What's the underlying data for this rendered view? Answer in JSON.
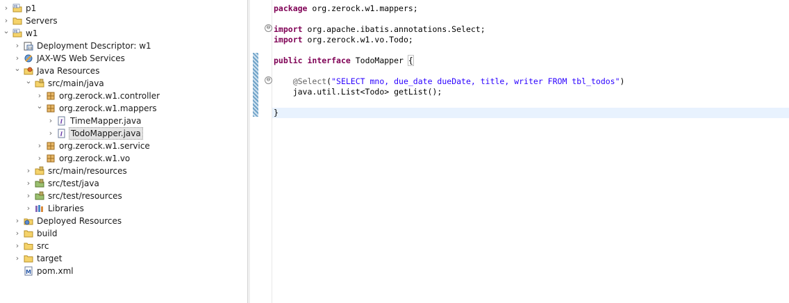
{
  "explorer": {
    "items": [
      {
        "label": "p1",
        "icon": "maven-project-icon",
        "expanded": false,
        "selected": false
      },
      {
        "label": "Servers",
        "icon": "folder-icon",
        "expanded": false,
        "selected": false
      },
      {
        "label": "w1",
        "icon": "maven-project-icon",
        "expanded": true,
        "selected": false
      },
      {
        "label": "Deployment Descriptor: w1",
        "icon": "deployment-descriptor-icon",
        "expanded": false,
        "selected": false
      },
      {
        "label": "JAX-WS Web Services",
        "icon": "web-services-icon",
        "expanded": false,
        "selected": false
      },
      {
        "label": "Java Resources",
        "icon": "java-resources-icon",
        "expanded": true,
        "selected": false
      },
      {
        "label": "src/main/java",
        "icon": "source-folder-icon",
        "expanded": true,
        "selected": false
      },
      {
        "label": "org.zerock.w1.controller",
        "icon": "package-icon",
        "expanded": false,
        "selected": false
      },
      {
        "label": "org.zerock.w1.mappers",
        "icon": "package-icon",
        "expanded": true,
        "selected": false
      },
      {
        "label": "TimeMapper.java",
        "icon": "java-interface-file-icon",
        "expanded": false,
        "selected": false
      },
      {
        "label": "TodoMapper.java",
        "icon": "java-interface-file-icon",
        "expanded": false,
        "selected": true
      },
      {
        "label": "org.zerock.w1.service",
        "icon": "package-icon",
        "expanded": false,
        "selected": false
      },
      {
        "label": "org.zerock.w1.vo",
        "icon": "package-icon",
        "expanded": false,
        "selected": false
      },
      {
        "label": "src/main/resources",
        "icon": "source-folder-icon",
        "expanded": false,
        "selected": false
      },
      {
        "label": "src/test/java",
        "icon": "test-source-folder-icon",
        "expanded": false,
        "selected": false
      },
      {
        "label": "src/test/resources",
        "icon": "test-source-folder-icon",
        "expanded": false,
        "selected": false
      },
      {
        "label": "Libraries",
        "icon": "libraries-icon",
        "expanded": false,
        "selected": false
      },
      {
        "label": "Deployed Resources",
        "icon": "deployed-resources-icon",
        "expanded": false,
        "selected": false
      },
      {
        "label": "build",
        "icon": "folder-icon",
        "expanded": false,
        "selected": false
      },
      {
        "label": "src",
        "icon": "folder-icon",
        "expanded": false,
        "selected": false
      },
      {
        "label": "target",
        "icon": "folder-icon",
        "expanded": false,
        "selected": false
      },
      {
        "label": "pom.xml",
        "icon": "maven-pom-file-icon",
        "expanded": null,
        "selected": false
      }
    ]
  },
  "editor": {
    "lines": [
      {
        "tokens": [
          {
            "t": "kw",
            "v": "package"
          },
          {
            "t": "plain",
            "v": " org.zerock.w1.mappers;"
          }
        ]
      },
      {
        "tokens": [
          {
            "t": "kw",
            "v": "import"
          },
          {
            "t": "plain",
            "v": " org.apache.ibatis.annotations.Select;"
          }
        ]
      },
      {
        "tokens": [
          {
            "t": "kw",
            "v": "import"
          },
          {
            "t": "plain",
            "v": " org.zerock.w1.vo.Todo;"
          }
        ]
      },
      {
        "tokens": [
          {
            "t": "kw",
            "v": "public"
          },
          {
            "t": "plain",
            "v": " "
          },
          {
            "t": "kw",
            "v": "interface"
          },
          {
            "t": "plain",
            "v": " TodoMapper "
          },
          {
            "t": "brace",
            "v": "{"
          }
        ]
      },
      {
        "tokens": [
          {
            "t": "plain",
            "v": "    "
          },
          {
            "t": "ann",
            "v": "@Select"
          },
          {
            "t": "plain",
            "v": "("
          },
          {
            "t": "str",
            "v": "\"SELECT mno, due_date dueDate, title, writer FROM tbl_todos\""
          },
          {
            "t": "plain",
            "v": ")"
          }
        ]
      },
      {
        "tokens": [
          {
            "t": "plain",
            "v": "    java.util.List<Todo> getList();"
          }
        ]
      },
      {
        "tokens": [
          {
            "t": "plain",
            "v": "}"
          }
        ]
      }
    ],
    "fold_markers": [
      "⊖",
      "⊖"
    ]
  },
  "colors": {
    "keyword": "#7f0055",
    "string": "#2a00ff",
    "annotation": "#646464",
    "current_line": "#e8f2fe",
    "selection": "#e4e4e4"
  }
}
